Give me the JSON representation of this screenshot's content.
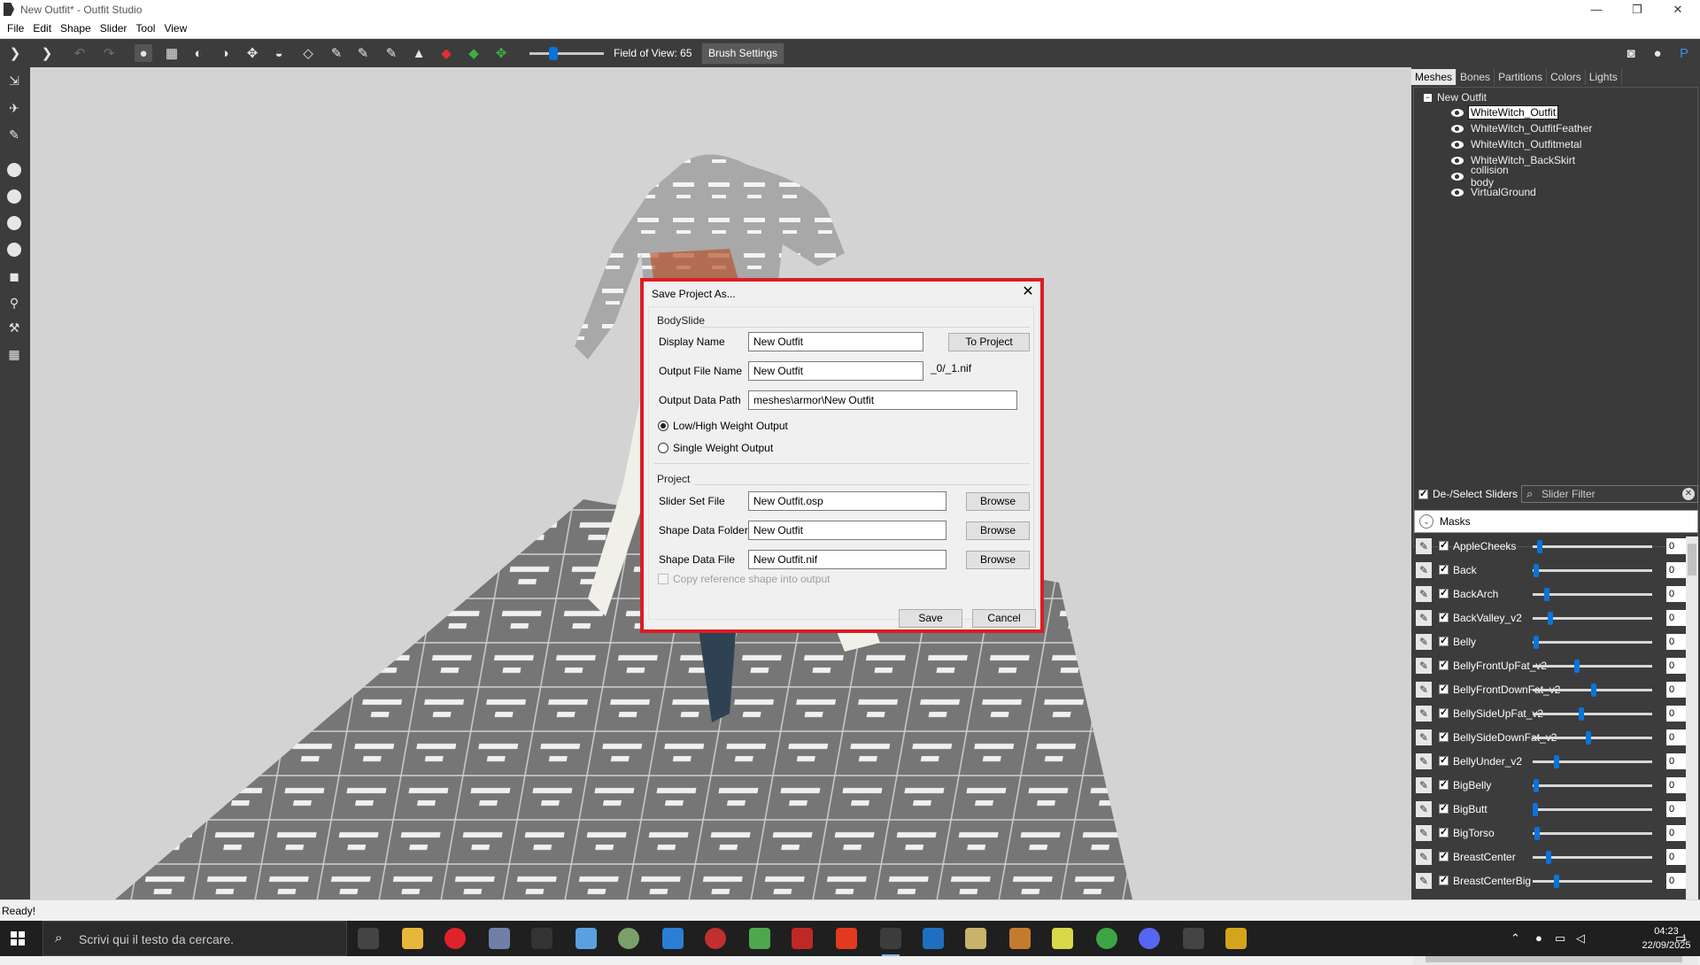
{
  "window": {
    "title": "New Outfit* - Outfit Studio",
    "minimize": "—",
    "restore": "❐",
    "close": "✕"
  },
  "menu": [
    "File",
    "Edit",
    "Shape",
    "Slider",
    "Tool",
    "View"
  ],
  "toolbar": {
    "fov_label": "Field of View: 65",
    "fov_value": 65,
    "brush_settings": "Brush Settings"
  },
  "panel": {
    "tabs": [
      "Meshes",
      "Bones",
      "Partitions",
      "Colors",
      "Lights"
    ],
    "active_tab": "Meshes",
    "tree_root": "New Outfit",
    "meshes": [
      "WhiteWitch_Outfit",
      "WhiteWitch_OutfitFeather",
      "WhiteWitch_Outfitmetal",
      "WhiteWitch_BackSkirt",
      "collision body",
      "VirtualGround"
    ],
    "selected_mesh": "WhiteWitch_Outfit",
    "deselect_label": "De-/Select Sliders",
    "slider_filter_placeholder": "Slider Filter",
    "masks_label": "Masks",
    "sliders": [
      {
        "name": "AppleCheeks",
        "value": "0",
        "pos": 0.06
      },
      {
        "name": "Back",
        "value": "0",
        "pos": 0.03
      },
      {
        "name": "BackArch",
        "value": "0",
        "pos": 0.12
      },
      {
        "name": "BackValley_v2",
        "value": "0",
        "pos": 0.15
      },
      {
        "name": "Belly",
        "value": "0",
        "pos": 0.03
      },
      {
        "name": "BellyFrontUpFat_v2",
        "value": "0",
        "pos": 0.37
      },
      {
        "name": "BellyFrontDownFat_v2",
        "value": "0",
        "pos": 0.51
      },
      {
        "name": "BellySideUpFat_v2",
        "value": "0",
        "pos": 0.41
      },
      {
        "name": "BellySideDownFat_v2",
        "value": "0",
        "pos": 0.47
      },
      {
        "name": "BellyUnder_v2",
        "value": "0",
        "pos": 0.2
      },
      {
        "name": "BigBelly",
        "value": "0",
        "pos": 0.03
      },
      {
        "name": "BigButt",
        "value": "0",
        "pos": 0.02
      },
      {
        "name": "BigTorso",
        "value": "0",
        "pos": 0.04
      },
      {
        "name": "BreastCenter",
        "value": "0",
        "pos": 0.13
      },
      {
        "name": "BreastCenterBig",
        "value": "0",
        "pos": 0.2
      }
    ]
  },
  "status": "Ready!",
  "dialog": {
    "title": "Save Project As...",
    "close": "✕",
    "bodyslide_group": "BodySlide",
    "display_name_label": "Display Name",
    "display_name_value": "New Outfit",
    "to_project": "To Project",
    "output_file_label": "Output File Name",
    "output_file_value": "New Outfit",
    "output_suffix": "_0/_1.nif",
    "output_path_label": "Output Data Path",
    "output_path_value": "meshes\\armor\\New Outfit",
    "radio_lowhigh": "Low/High Weight Output",
    "radio_single": "Single Weight Output",
    "project_group": "Project",
    "slider_set_label": "Slider Set File",
    "slider_set_value": "New Outfit.osp",
    "shape_folder_label": "Shape Data Folder",
    "shape_folder_value": "New Outfit",
    "shape_file_label": "Shape Data File",
    "shape_file_value": "New Outfit.nif",
    "browse": "Browse",
    "copy_ref": "Copy reference shape into output",
    "save": "Save",
    "cancel": "Cancel"
  },
  "taskbar": {
    "search_placeholder": "Scrivi qui il testo da cercare.",
    "time": "04:23",
    "date": "22/09/2025",
    "notification_count": "1"
  },
  "colors": {
    "accent": "#0a74da",
    "highlight": "#dc1c24",
    "toolbar": "#3c3c3c"
  }
}
